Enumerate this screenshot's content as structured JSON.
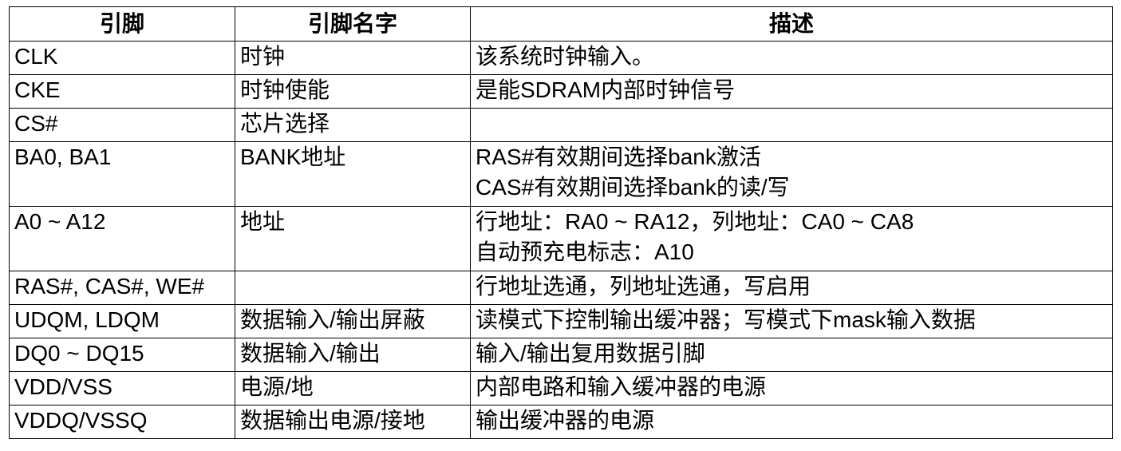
{
  "table": {
    "headers": [
      "引脚",
      "引脚名字",
      "描述"
    ],
    "rows": [
      {
        "pin": "CLK",
        "name": "时钟",
        "desc": [
          "该系统时钟输入。"
        ]
      },
      {
        "pin": "CKE",
        "name": "时钟使能",
        "desc": [
          "是能SDRAM内部时钟信号"
        ]
      },
      {
        "pin": "CS#",
        "name": "芯片选择",
        "desc": [
          ""
        ]
      },
      {
        "pin": "BA0, BA1",
        "name": "BANK地址",
        "desc": [
          "RAS#有效期间选择bank激活",
          "CAS#有效期间选择bank的读/写"
        ]
      },
      {
        "pin": "A0 ~ A12",
        "name": "地址",
        "desc": [
          "行地址：RA0 ~ RA12，列地址：CA0 ~ CA8",
          "自动预充电标志：A10"
        ]
      },
      {
        "pin": "RAS#, CAS#, WE#",
        "name": "",
        "desc": [
          "行地址选通，列地址选通，写启用"
        ]
      },
      {
        "pin": "UDQM, LDQM",
        "name": "数据输入/输出屏蔽",
        "desc": [
          "读模式下控制输出缓冲器；写模式下mask输入数据"
        ]
      },
      {
        "pin": "DQ0 ~ DQ15",
        "name": "数据输入/输出",
        "desc": [
          "输入/输出复用数据引脚"
        ]
      },
      {
        "pin": "VDD/VSS",
        "name": "电源/地",
        "desc": [
          "内部电路和输入缓冲器的电源"
        ]
      },
      {
        "pin": "VDDQ/VSSQ",
        "name": "数据输出电源/接地",
        "desc": [
          "输出缓冲器的电源"
        ]
      }
    ]
  }
}
